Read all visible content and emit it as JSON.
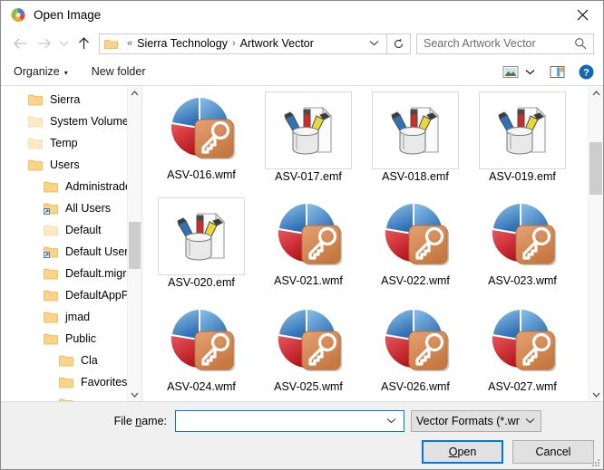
{
  "window": {
    "title": "Open Image",
    "title_icon": "app-pinwheel-icon",
    "close_label": "✕"
  },
  "address": {
    "back_icon": "arrow-left-icon",
    "forward_icon": "arrow-right-icon",
    "history_icon": "chevron-down-icon",
    "up_icon": "arrow-up-icon",
    "folder_icon": "folder-icon",
    "chevrons": "«",
    "crumb1": "Sierra Technology",
    "separator": "›",
    "crumb2": "Artwork Vector",
    "dropdown_icon": "chevron-down-icon",
    "refresh_icon": "refresh-icon"
  },
  "search": {
    "placeholder": "Search Artwork Vector",
    "value": "",
    "icon": "search-icon"
  },
  "toolbar": {
    "organize_label": "Organize",
    "organize_caret": "▾",
    "new_folder_label": "New folder",
    "view_icon": "view-thumbnail-icon",
    "view_caret": "▾",
    "preview_pane_icon": "preview-pane-icon",
    "help_icon": "help-icon"
  },
  "sidebar": {
    "scroll_up": "⌃",
    "scroll_down": "⌄",
    "items": [
      {
        "label": "Sierra",
        "icon": "folder-icon",
        "indent": 0,
        "type": "folder"
      },
      {
        "label": "System Volume",
        "icon": "folder-icon",
        "indent": 0,
        "type": "folder-pale"
      },
      {
        "label": "Temp",
        "icon": "folder-icon",
        "indent": 0,
        "type": "folder-pale"
      },
      {
        "label": "Users",
        "icon": "folder-icon",
        "indent": 0,
        "type": "folder"
      },
      {
        "label": "Administrado",
        "icon": "folder-icon",
        "indent": 1,
        "type": "folder"
      },
      {
        "label": "All Users",
        "icon": "folder-shortcut-icon",
        "indent": 1,
        "type": "shortcut"
      },
      {
        "label": "Default",
        "icon": "folder-icon",
        "indent": 1,
        "type": "folder-pale"
      },
      {
        "label": "Default User",
        "icon": "folder-shortcut-icon",
        "indent": 1,
        "type": "shortcut"
      },
      {
        "label": "Default.migra",
        "icon": "folder-icon",
        "indent": 1,
        "type": "folder"
      },
      {
        "label": "DefaultAppPo",
        "icon": "folder-icon",
        "indent": 1,
        "type": "folder"
      },
      {
        "label": "jmad",
        "icon": "folder-icon",
        "indent": 1,
        "type": "folder"
      },
      {
        "label": "Public",
        "icon": "folder-icon",
        "indent": 1,
        "type": "folder"
      },
      {
        "label": "Cla",
        "icon": "folder-icon",
        "indent": 2,
        "type": "folder"
      },
      {
        "label": "Favorites",
        "icon": "folder-icon",
        "indent": 2,
        "type": "folder"
      },
      {
        "label": "",
        "icon": "folder-icon",
        "indent": 2,
        "type": "folder"
      }
    ]
  },
  "files": {
    "scroll_up": "⌃",
    "scroll_down": "⌄",
    "items": [
      {
        "name": "ASV-016.wmf",
        "icon": "wmf-key-icon",
        "boxed": false
      },
      {
        "name": "ASV-017.emf",
        "icon": "emf-pencils-icon",
        "boxed": true
      },
      {
        "name": "ASV-018.emf",
        "icon": "emf-pencils-icon",
        "boxed": true
      },
      {
        "name": "ASV-019.emf",
        "icon": "emf-pencils-icon",
        "boxed": true
      },
      {
        "name": "ASV-020.emf",
        "icon": "emf-pencils-icon",
        "boxed": true
      },
      {
        "name": "ASV-021.wmf",
        "icon": "wmf-key-icon",
        "boxed": false
      },
      {
        "name": "ASV-022.wmf",
        "icon": "wmf-key-icon",
        "boxed": false
      },
      {
        "name": "ASV-023.wmf",
        "icon": "wmf-key-icon",
        "boxed": false
      },
      {
        "name": "ASV-024.wmf",
        "icon": "wmf-key-icon",
        "boxed": false
      },
      {
        "name": "ASV-025.wmf",
        "icon": "wmf-key-icon",
        "boxed": false
      },
      {
        "name": "ASV-026.wmf",
        "icon": "wmf-key-icon",
        "boxed": false
      },
      {
        "name": "ASV-027.wmf",
        "icon": "wmf-key-icon",
        "boxed": false
      }
    ]
  },
  "footer": {
    "file_name_label_pre": "File ",
    "file_name_label_accel": "n",
    "file_name_label_post": "ame:",
    "file_name_value": "",
    "file_name_caret": "⌄",
    "filter_value": "Vector Formats (*.wmf;*.emf;*.c",
    "filter_caret": "⌄",
    "open_pre": "",
    "open_accel": "O",
    "open_post": "pen",
    "cancel_label": "Cancel"
  },
  "colors": {
    "accent": "#0078d7",
    "folder": "#fcc24c",
    "button_face": "#e1e1e1",
    "footer_bg": "#f0f0f0"
  }
}
